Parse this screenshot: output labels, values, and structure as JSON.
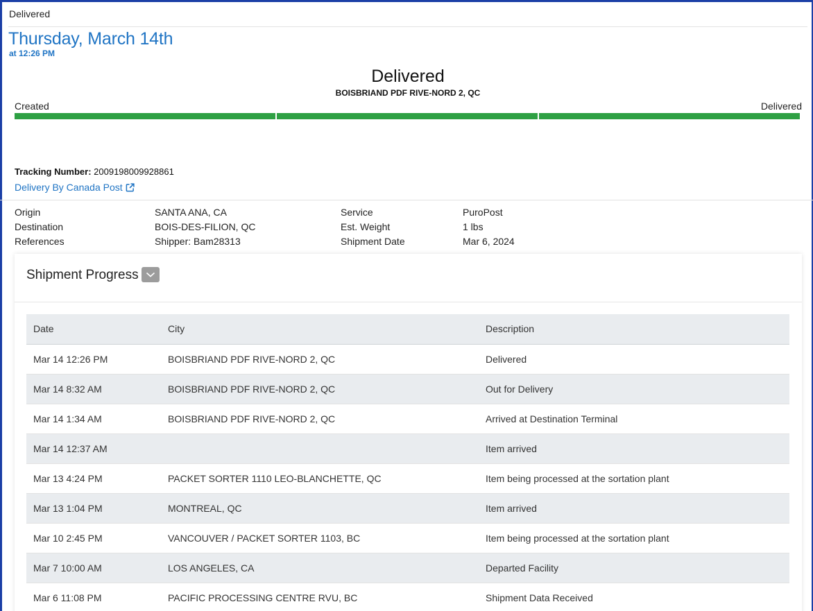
{
  "header": {
    "status_small": "Delivered",
    "date_title": "Thursday, March 14th",
    "date_time": "at 12:26 PM"
  },
  "status": {
    "title": "Delivered",
    "location": "BOISBRIAND PDF RIVE-NORD 2, QC",
    "progress_start_label": "Created",
    "progress_end_label": "Delivered",
    "progress_fraction": 1.0,
    "progress_color": "#2ea043"
  },
  "tracking": {
    "label": "Tracking Number:",
    "number": "2009198009928861",
    "carrier_link": "Delivery By Canada Post",
    "link_icon": "external-link-icon"
  },
  "info": {
    "origin_label": "Origin",
    "origin_value": "SANTA ANA, CA",
    "destination_label": "Destination",
    "destination_value": "BOIS-DES-FILION, QC",
    "references_label": "References",
    "references_value": "Shipper: Bam28313",
    "service_label": "Service",
    "service_value": "PuroPost",
    "weight_label": "Est. Weight",
    "weight_value": "1 lbs",
    "shipdate_label": "Shipment Date",
    "shipdate_value": "Mar 6, 2024"
  },
  "progress_card": {
    "title": "Shipment Progress",
    "toggle_icon": "chevron-down-icon",
    "columns": [
      "Date",
      "City",
      "Description"
    ],
    "rows": [
      [
        "Mar 14 12:26 PM",
        "BOISBRIAND PDF RIVE-NORD 2, QC",
        "Delivered"
      ],
      [
        "Mar 14 8:32 AM",
        "BOISBRIAND PDF RIVE-NORD 2, QC",
        "Out for Delivery"
      ],
      [
        "Mar 14 1:34 AM",
        "BOISBRIAND PDF RIVE-NORD 2, QC",
        "Arrived at Destination Terminal"
      ],
      [
        "Mar 14 12:37 AM",
        "",
        "Item arrived"
      ],
      [
        "Mar 13 4:24 PM",
        "PACKET SORTER 1110 LEO-BLANCHETTE, QC",
        "Item being processed at the sortation plant"
      ],
      [
        "Mar 13 1:04 PM",
        "MONTREAL, QC",
        "Item arrived"
      ],
      [
        "Mar 10 2:45 PM",
        "VANCOUVER / PACKET SORTER 1103, BC",
        "Item being processed at the sortation plant"
      ],
      [
        "Mar 7 10:00 AM",
        "LOS ANGELES, CA",
        "Departed Facility"
      ],
      [
        "Mar 6 11:08 PM",
        "PACIFIC PROCESSING CENTRE RVU, BC",
        "Shipment Data Received"
      ]
    ]
  },
  "colors": {
    "accent": "#1f74c4",
    "window_border": "#1b3fa6",
    "row_alt": "#e9ecef"
  }
}
